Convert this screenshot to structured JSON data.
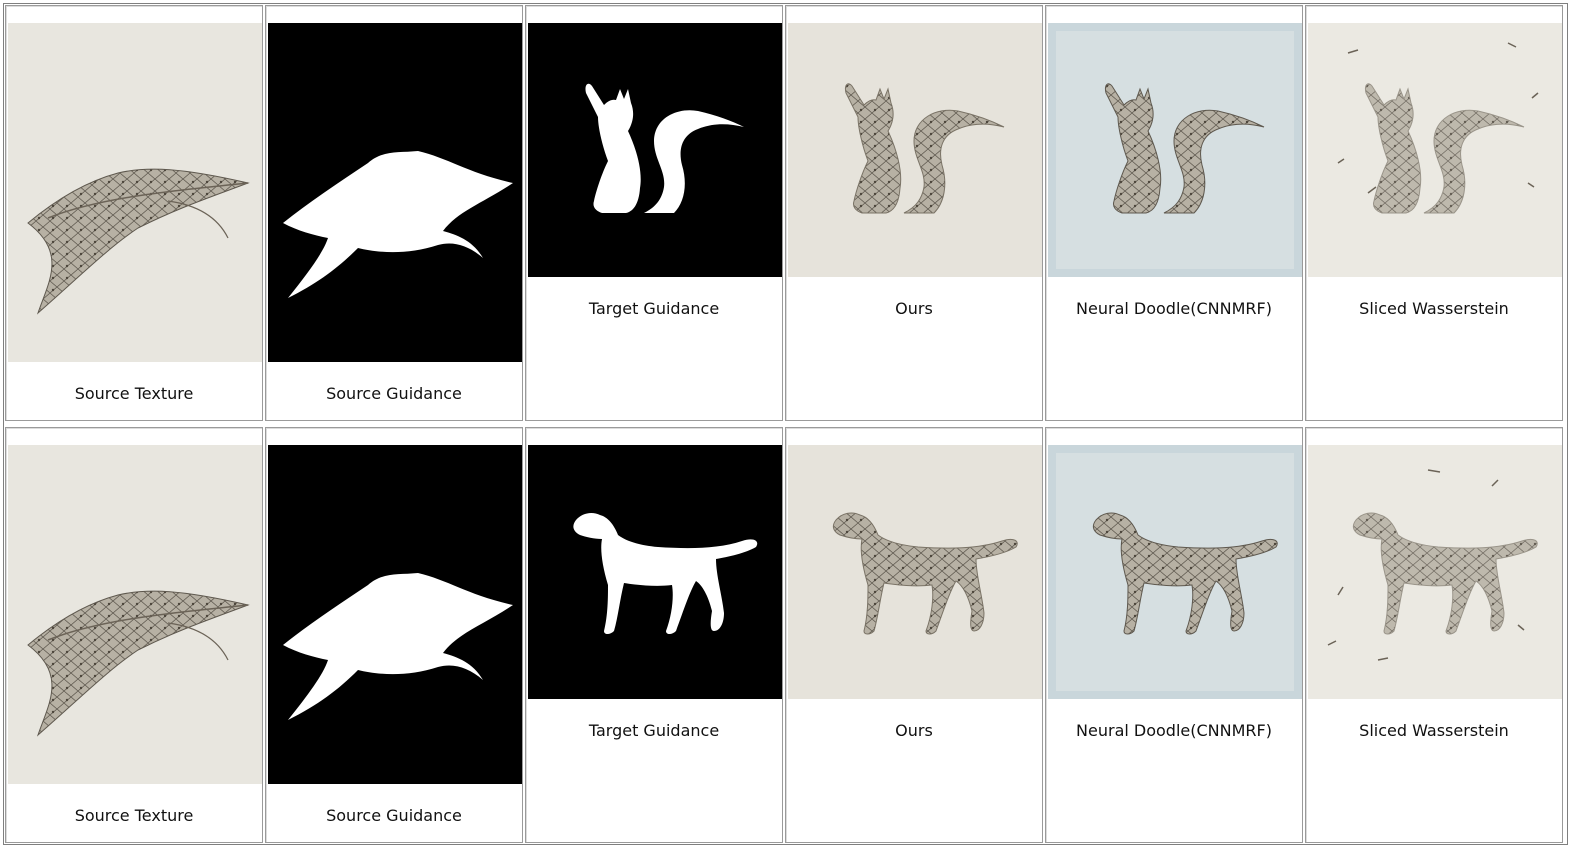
{
  "rows": [
    {
      "cells": [
        {
          "caption": "Source Texture",
          "image": "leaf-texture"
        },
        {
          "caption": "Source Guidance",
          "image": "leaf-mask"
        },
        {
          "caption": "Target Guidance",
          "image": "cat-mask"
        },
        {
          "caption": "Ours",
          "image": "cat-result-ours"
        },
        {
          "caption": "Neural Doodle(CNNMRF)",
          "image": "cat-result-neural-doodle"
        },
        {
          "caption": "Sliced Wasserstein",
          "image": "cat-result-sliced-wasserstein"
        }
      ]
    },
    {
      "cells": [
        {
          "caption": "Source Texture",
          "image": "leaf-texture"
        },
        {
          "caption": "Source Guidance",
          "image": "leaf-mask"
        },
        {
          "caption": "Target Guidance",
          "image": "dog-mask"
        },
        {
          "caption": "Ours",
          "image": "dog-result-ours"
        },
        {
          "caption": "Neural Doodle(CNNMRF)",
          "image": "dog-result-neural-doodle"
        },
        {
          "caption": "Sliced Wasserstein",
          "image": "dog-result-sliced-wasserstein"
        }
      ]
    }
  ],
  "colors": {
    "paper": "#e9e7e0",
    "paper_blue": "#c9d6db",
    "texture": "#8d877b",
    "texture_dark": "#5e584e",
    "mask_bg": "#000000",
    "mask_fg": "#ffffff"
  }
}
